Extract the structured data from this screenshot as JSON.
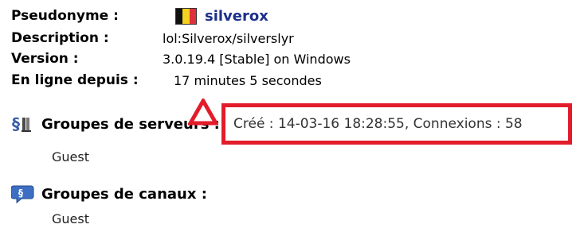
{
  "info": {
    "nickname_label": "Pseudonyme :",
    "nickname": "silverox",
    "flag_colors": [
      "#111111",
      "#f4d21f",
      "#e0303c"
    ],
    "description_label": "Description :",
    "description": "lol:Silverox/silverslyr",
    "version_label": "Version :",
    "version": "3.0.19.4 [Stable] on Windows",
    "online_label": "En ligne depuis :",
    "online": "17 minutes 5 secondes"
  },
  "server_groups": {
    "title": "Groupes de serveurs :",
    "items": [
      "Guest"
    ]
  },
  "channel_groups": {
    "title": "Groupes de canaux :",
    "items": [
      "Guest"
    ]
  },
  "tooltip": {
    "text": "Créé : 14-03-16 18:28:55, Connexions : 58",
    "border_color": "#e21c2a"
  }
}
